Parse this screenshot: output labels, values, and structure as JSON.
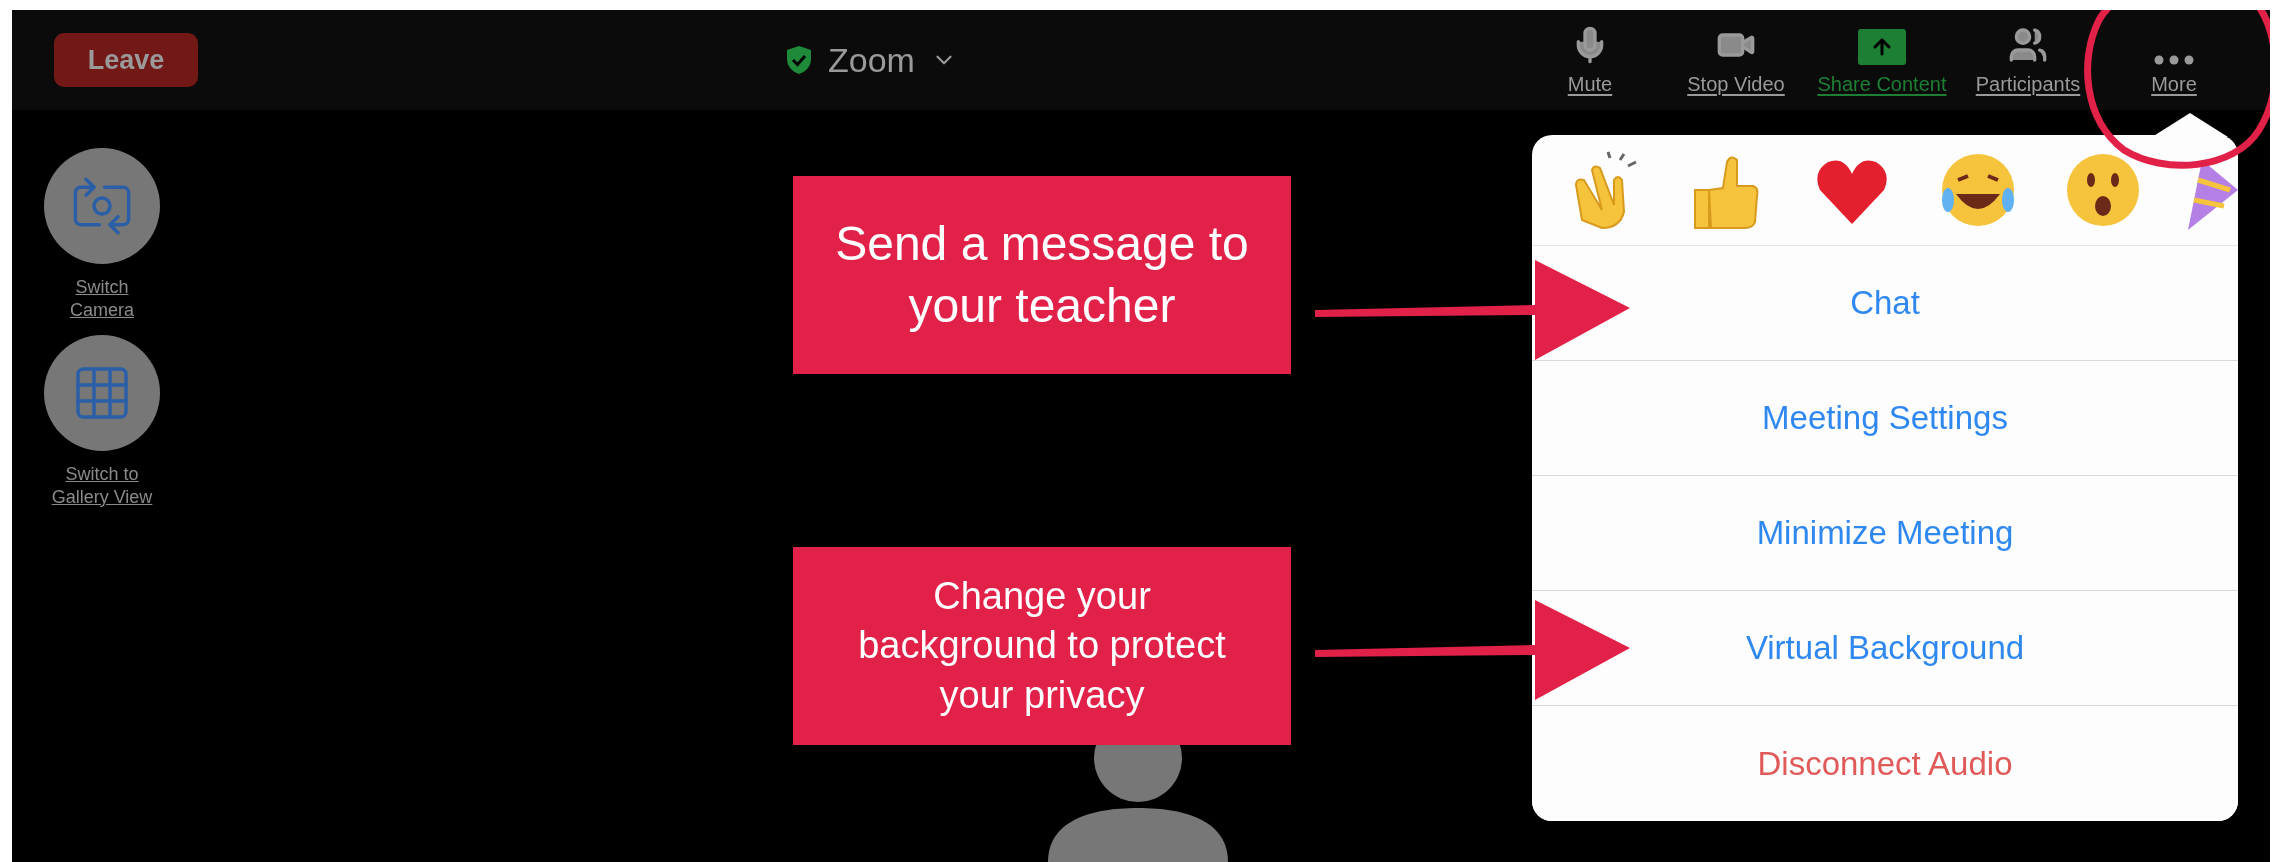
{
  "top_bar": {
    "leave_button": "Leave",
    "title": "Zoom",
    "secure": true,
    "toolbar": [
      {
        "kind": "mic",
        "label": "Mute",
        "highlighted": false
      },
      {
        "kind": "video",
        "label": "Stop Video",
        "highlighted": false
      },
      {
        "kind": "share",
        "label": "Share Content",
        "highlighted": true
      },
      {
        "kind": "participants",
        "label": "Participants",
        "highlighted": false
      },
      {
        "kind": "more",
        "label": "More",
        "highlighted": false
      }
    ]
  },
  "side_controls": [
    {
      "kind": "camera",
      "label": "Switch Camera"
    },
    {
      "kind": "gallery",
      "label": "Switch to Gallery View"
    }
  ],
  "more_menu": {
    "items": [
      {
        "label": "Chat",
        "kind": "action"
      },
      {
        "label": "Meeting Settings",
        "kind": "action"
      },
      {
        "label": "Minimize Meeting",
        "kind": "action"
      },
      {
        "label": "Virtual Background",
        "kind": "action"
      },
      {
        "label": "Disconnect Audio",
        "kind": "destructive"
      }
    ]
  },
  "annotations": [
    {
      "text": "Send a message to your teacher"
    },
    {
      "text": "Change your background to protect your privacy"
    }
  ]
}
